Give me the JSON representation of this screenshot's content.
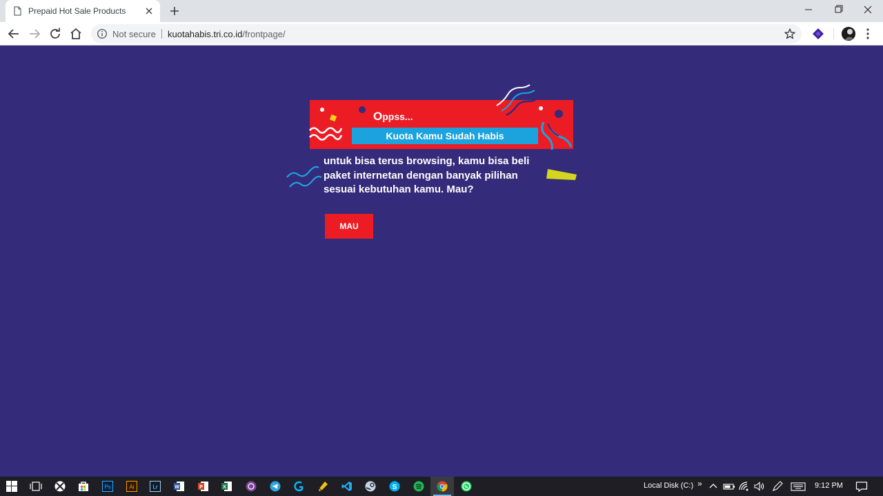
{
  "browser": {
    "tab_title": "Prepaid Hot Sale Products",
    "security_label": "Not secure",
    "url_host": "kuotahabis.tri.co.id",
    "url_path": "/frontpage/"
  },
  "page": {
    "heading": "ppss...",
    "heading_first_letter": "O",
    "subtitle": "Kuota Kamu Sudah Habis",
    "message_lines": [
      "untuk bisa terus browsing, kamu bisa beli",
      "paket internetan dengan banyak pilihan",
      "sesuai kebutuhan kamu. Mau?"
    ],
    "button_label": "MAU",
    "colors": {
      "background": "#352b7b",
      "banner_red": "#ec1c24",
      "subtitle_blue": "#1ca3dd",
      "accent_yellow": "#d4d61e"
    }
  },
  "taskbar": {
    "apps": [
      "start-icon",
      "task-view-icon",
      "xbox-icon",
      "store-icon",
      "photoshop-icon",
      "illustrator-icon",
      "lightroom-icon",
      "word-icon",
      "powerpoint-icon",
      "excel-icon",
      "tor-icon",
      "telegram-icon",
      "logitech-icon",
      "pencil-app-icon",
      "vscode-icon",
      "steam-icon",
      "skype-icon",
      "spotify-icon",
      "chrome-icon",
      "whatsapp-icon"
    ],
    "drive_label": "Local Disk (C:)",
    "overflow_label": "»",
    "time": "9:12 PM"
  }
}
